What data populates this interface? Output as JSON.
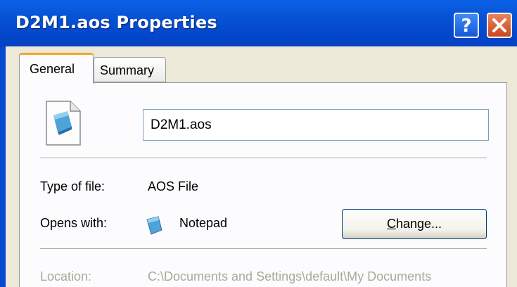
{
  "window": {
    "title": "D2M1.aos Properties",
    "help_label": "?",
    "close_label": "✕"
  },
  "tabs": [
    {
      "label": "General",
      "active": true
    },
    {
      "label": "Summary",
      "active": false
    }
  ],
  "general": {
    "file_name": "D2M1.aos",
    "type_of_file_label": "Type of file:",
    "type_of_file_value": "AOS File",
    "opens_with_label": "Opens with:",
    "opens_with_value": "Notepad",
    "change_button": {
      "mnemonic": "C",
      "rest": "hange..."
    },
    "location_label": "Location:",
    "location_value": "C:\\Documents and Settings\\default\\My Documents"
  },
  "icons": {
    "file": "document-file-icon",
    "notepad": "notepad-app-icon",
    "help": "help-icon",
    "close": "close-icon"
  },
  "colors": {
    "titlebar": "#0553d4",
    "dialog_bg": "#ece9d8",
    "tab_accent": "#f0a630",
    "close_button": "#d4562b"
  }
}
